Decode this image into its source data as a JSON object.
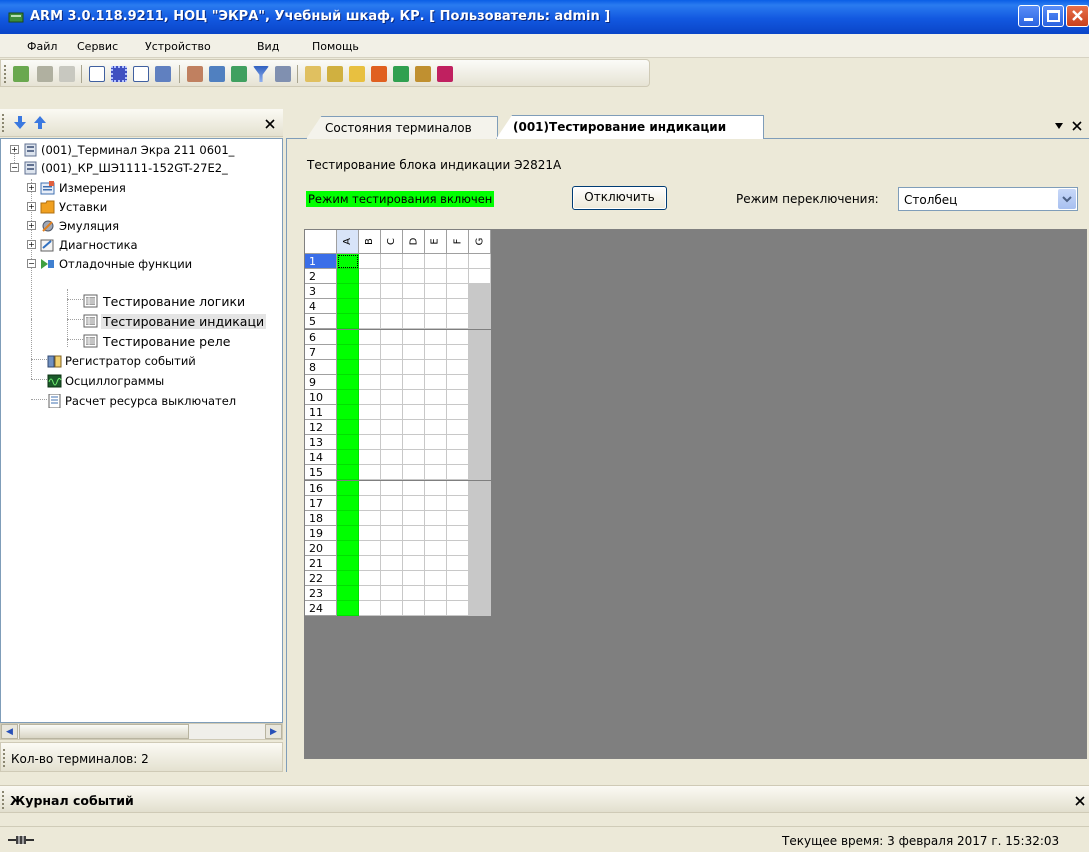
{
  "window": {
    "title": "ARM 3.0.118.9211, НОЦ \"ЭКРА\", Учебный шкаф, КР. [ Пользователь: admin ]"
  },
  "menu": [
    "Файл",
    "Сервис",
    "Устройство",
    "Вид",
    "Помощь"
  ],
  "toolbar_icons": [
    "terminal-icon",
    "connect-icon",
    "panel-icon",
    "list-icon",
    "grid-icon",
    "link-icon",
    "window-icon",
    "report-icon",
    "edit-icon",
    "tree-icon",
    "filter-icon",
    "settings-icon",
    "find-icon",
    "chart-icon",
    "sign-icon",
    "rss-icon",
    "sync-icon",
    "tools-icon",
    "book-icon"
  ],
  "left_panel": {
    "tree": [
      {
        "label": "(001)_Терминал Экра 211 0601_",
        "icon": "terminal-icon",
        "level": 0,
        "expander": "+"
      },
      {
        "label": "(001)_КР_ШЭ1111-152GT-27Е2_",
        "icon": "terminal-icon",
        "level": 0,
        "expander": "-"
      },
      {
        "label": "Измерения",
        "icon": "measure-icon",
        "level": 1,
        "expander": "+"
      },
      {
        "label": "Уставки",
        "icon": "folder-icon",
        "level": 1,
        "expander": "+"
      },
      {
        "label": "Эмуляция",
        "icon": "emulation-icon",
        "level": 1,
        "expander": "+"
      },
      {
        "label": "Диагностика",
        "icon": "diagnostics-icon",
        "level": 1,
        "expander": "+"
      },
      {
        "label": "Отладочные функции",
        "icon": "debug-icon",
        "level": 1,
        "expander": "-"
      },
      {
        "label": "Тестирование логики",
        "icon": "table-icon",
        "level": 2,
        "expander": ""
      },
      {
        "label": "Тестирование индикаци",
        "icon": "table-icon",
        "level": 2,
        "expander": ""
      },
      {
        "label": "Тестирование реле",
        "icon": "table-icon",
        "level": 2,
        "expander": ""
      },
      {
        "label": "Регистратор событий",
        "icon": "book-icon",
        "level": 1,
        "expander": ""
      },
      {
        "label": "Осциллограммы",
        "icon": "oscillogram-icon",
        "level": 1,
        "expander": ""
      },
      {
        "label": "Расчет ресурса выключател",
        "icon": "calc-icon",
        "level": 1,
        "expander": ""
      }
    ],
    "status": "Кол-во терминалов: 2"
  },
  "tabs": [
    "Состояния терминалов",
    "(001)Тестирование индикации"
  ],
  "content": {
    "heading": "Тестирование блока индикации Э2821А",
    "mode_status": "Режим тестирования включен",
    "disable_button": "Отключить",
    "switch_mode_label": "Режим переключения:",
    "switch_mode_value": "Столбец"
  },
  "grid": {
    "columns": [
      "A",
      "B",
      "C",
      "D",
      "E",
      "F",
      "G"
    ],
    "rows": [
      "1",
      "2",
      "3",
      "4",
      "5",
      "6",
      "7",
      "8",
      "9",
      "10",
      "11",
      "12",
      "13",
      "14",
      "15",
      "16",
      "17",
      "18",
      "19",
      "20",
      "21",
      "22",
      "23",
      "24"
    ]
  },
  "journal": {
    "title": "Журнал событий"
  },
  "statusbar": {
    "time": "Текущее время: 3 февраля 2017 г. 15:32:03"
  }
}
